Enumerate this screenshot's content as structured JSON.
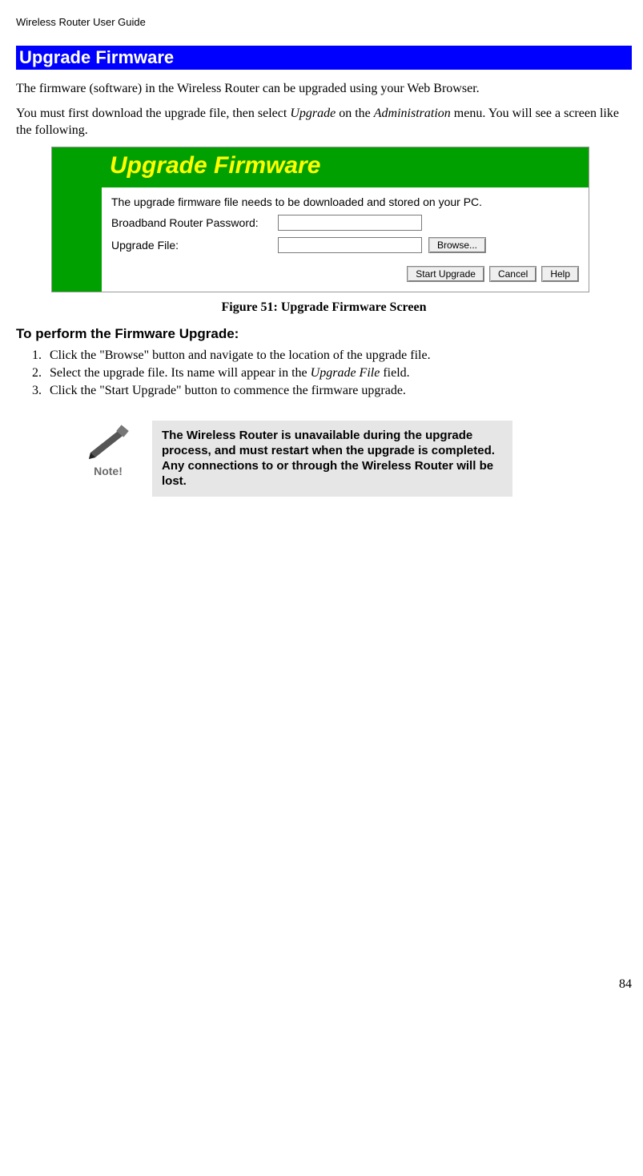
{
  "header": {
    "guide_title": "Wireless Router User Guide"
  },
  "section": {
    "title": "Upgrade Firmware"
  },
  "intro": {
    "p1": "The firmware (software) in the Wireless Router can be upgraded using your Web Browser.",
    "p2_a": "You must first download the upgrade file, then select ",
    "p2_italic1": "Upgrade",
    "p2_b": " on the ",
    "p2_italic2": "Administration",
    "p2_c": " menu. You will see a screen like the following."
  },
  "ui": {
    "title": "Upgrade Firmware",
    "body_text": "The upgrade firmware file needs to be downloaded and stored on your PC.",
    "row1_label": "Broadband Router Password:",
    "row2_label": "Upgrade File:",
    "browse_btn": "Browse...",
    "actions": {
      "start": "Start Upgrade",
      "cancel": "Cancel",
      "help": "Help"
    }
  },
  "figure_caption": "Figure 51: Upgrade Firmware Screen",
  "subheading": "To perform the Firmware Upgrade:",
  "steps": {
    "s1": "Click the \"Browse\" button and navigate to the location of the upgrade file.",
    "s2_a": "Select the upgrade file. Its name will appear in the ",
    "s2_i": "Upgrade File",
    "s2_b": " field.",
    "s3": "Click the \"Start Upgrade\" button to commence the firmware upgrade."
  },
  "note": {
    "label": "Note!",
    "text": "The Wireless Router is unavailable during the upgrade process, and must restart when the upgrade is completed. Any connections to or through the Wireless Router will be lost."
  },
  "page_number": "84"
}
